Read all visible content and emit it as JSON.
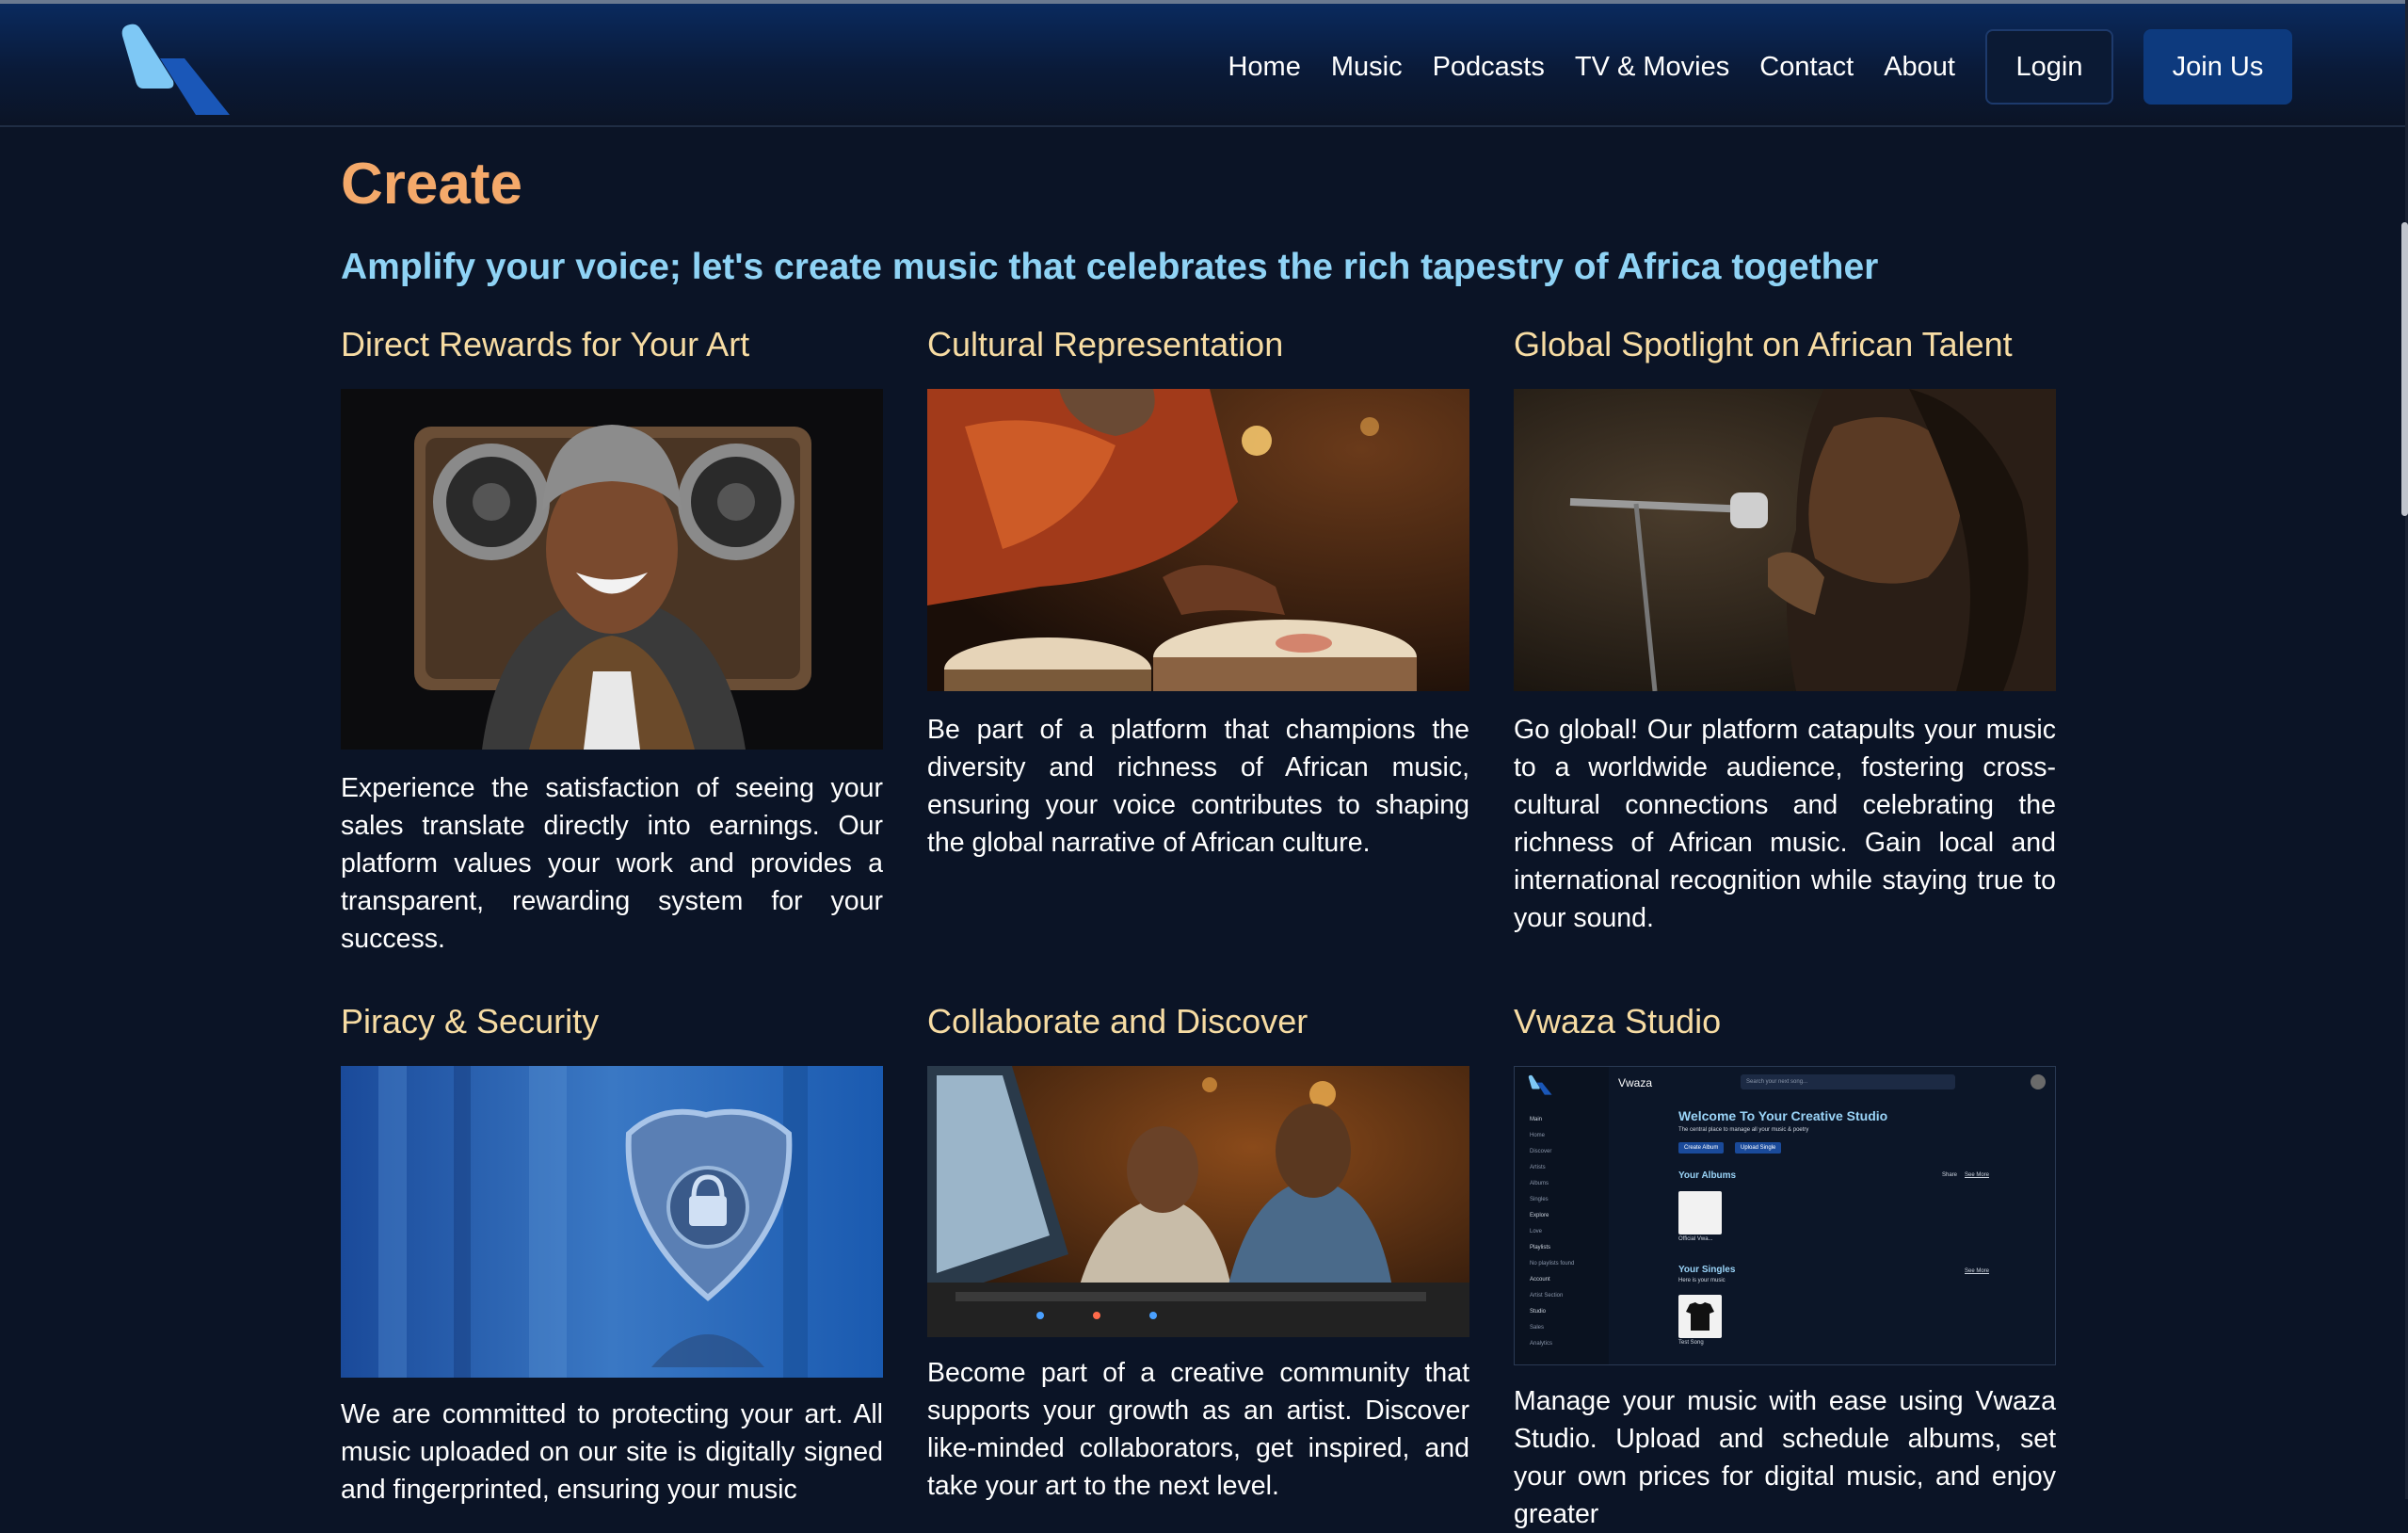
{
  "nav": {
    "links": [
      "Home",
      "Music",
      "Podcasts",
      "TV & Movies",
      "Contact",
      "About"
    ],
    "login_label": "Login",
    "join_label": "Join Us"
  },
  "page": {
    "title": "Create",
    "subtitle": "Amplify your voice; let's create music that celebrates the rich tapestry of Africa together"
  },
  "cards": [
    {
      "title": "Direct Rewards for Your Art",
      "text": "Experience the satisfaction of seeing your sales translate directly into earnings. Our platform values your work and provides a transparent, rewarding system for your success."
    },
    {
      "title": "Cultural Representation",
      "text": "Be part of a platform that champions the diversity and richness of African music, ensuring your voice contributes to shaping the global narrative of African culture."
    },
    {
      "title": "Global Spotlight on African Talent",
      "text": "Go global! Our platform catapults your music to a worldwide audience, fostering cross-cultural connections and celebrating the richness of African music. Gain local and international recognition while staying true to your sound."
    },
    {
      "title": "Piracy & Security",
      "text": "We are committed to protecting your art. All music uploaded on our site is digitally signed and fingerprinted, ensuring your music"
    },
    {
      "title": "Collaborate and Discover",
      "text": "Become part of a creative community that supports your growth as an artist. Discover like-minded collaborators, get inspired, and take your art to the next level."
    },
    {
      "title": "Vwaza Studio",
      "text": "Manage your music with ease using Vwaza Studio. Upload and schedule albums, set your own prices for digital music, and enjoy greater"
    }
  ],
  "studio_preview": {
    "brand": "Vwaza",
    "search_placeholder": "Search your next song...",
    "welcome": "Welcome To Your Creative Studio",
    "welcome_sub": "The central place to manage all your music & poetry",
    "create_album": "Create Album",
    "upload_single": "Upload Single",
    "albums_heading": "Your Albums",
    "albums_sort": "Share",
    "see_more": "See More",
    "album_name": "Official Vwa...",
    "singles_heading": "Your Singles",
    "singles_sub": "Here is your music",
    "single_name": "Test Song",
    "sidebar": [
      "Main",
      "Home",
      "Discover",
      "Artists",
      "Albums",
      "Singles",
      "Explore",
      "Love",
      "Playlists",
      "No playlists found",
      "Account",
      "Artist Section",
      "Studio",
      "Sales",
      "Analytics"
    ]
  },
  "icons": {
    "logo": "vwaza-logo",
    "image_1": "boombox-artist-photo",
    "image_2": "drummer-photo",
    "image_3": "singer-microphone-photo",
    "image_4": "padlock-shield-photo",
    "image_5": "studio-producers-photo",
    "image_6": "studio-dashboard-screenshot"
  },
  "colors": {
    "background": "#0b1426",
    "title": "#f4a96a",
    "subtitle": "#8fd3f5",
    "card_heading": "#f7dca3",
    "join_button": "#0d3a7e"
  }
}
